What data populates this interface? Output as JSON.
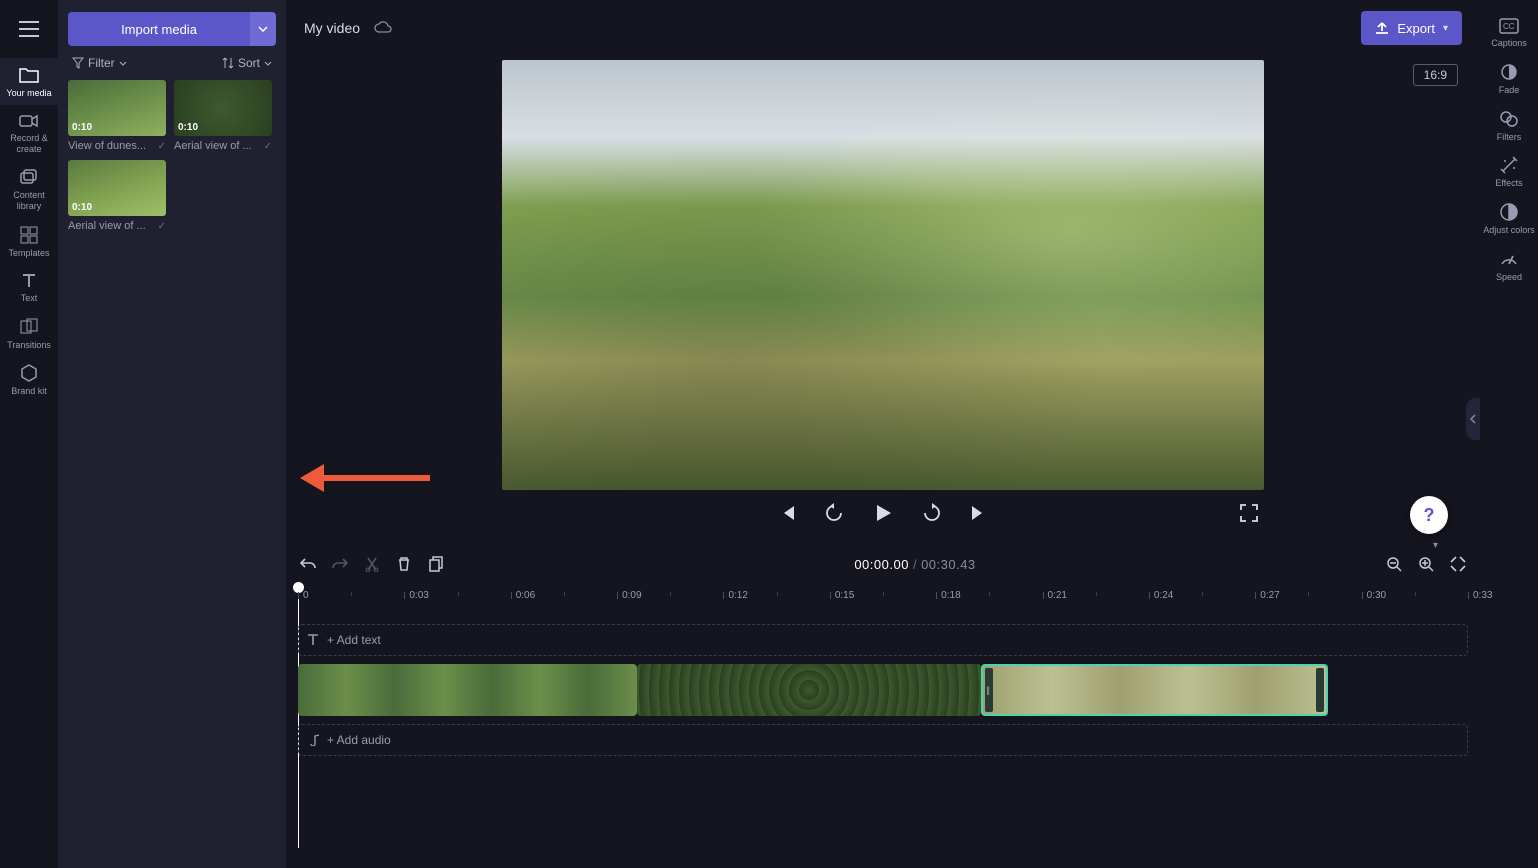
{
  "header": {
    "title": "My video",
    "export_label": "Export",
    "aspect": "16:9"
  },
  "import_button": "Import media",
  "filter_label": "Filter",
  "sort_label": "Sort",
  "leftnav": [
    {
      "label": "Your media",
      "name": "your-media"
    },
    {
      "label": "Record & create",
      "name": "record-create"
    },
    {
      "label": "Content library",
      "name": "content-library"
    },
    {
      "label": "Templates",
      "name": "templates"
    },
    {
      "label": "Text",
      "name": "text"
    },
    {
      "label": "Transitions",
      "name": "transitions"
    },
    {
      "label": "Brand kit",
      "name": "brand-kit"
    }
  ],
  "rightnav": [
    {
      "label": "Captions",
      "name": "captions"
    },
    {
      "label": "Fade",
      "name": "fade"
    },
    {
      "label": "Filters",
      "name": "filters"
    },
    {
      "label": "Effects",
      "name": "effects"
    },
    {
      "label": "Adjust colors",
      "name": "adjust-colors"
    },
    {
      "label": "Speed",
      "name": "speed"
    }
  ],
  "media": [
    {
      "duration": "0:10",
      "label": "View of dunes..."
    },
    {
      "duration": "0:10",
      "label": "Aerial view of ..."
    },
    {
      "duration": "0:10",
      "label": "Aerial view of ..."
    }
  ],
  "timeline": {
    "current": "00:00.00",
    "total": "00:30.43",
    "add_text": "+ Add text",
    "add_audio": "+ Add audio",
    "ticks": [
      "0",
      "0:03",
      "0:06",
      "0:09",
      "0:12",
      "0:15",
      "0:18",
      "0:21",
      "0:24",
      "0:27",
      "0:30",
      "0:33"
    ]
  }
}
